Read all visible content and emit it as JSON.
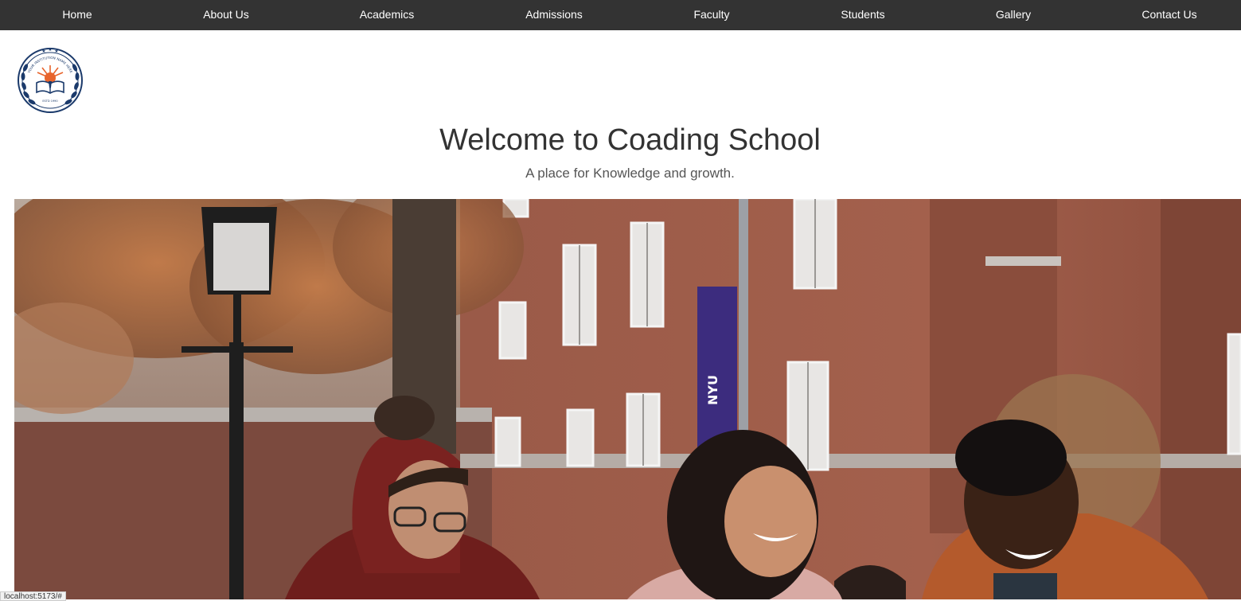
{
  "nav": {
    "items": [
      {
        "label": "Home"
      },
      {
        "label": "About Us"
      },
      {
        "label": "Academics"
      },
      {
        "label": "Admissions"
      },
      {
        "label": "Faculty"
      },
      {
        "label": "Students"
      },
      {
        "label": "Gallery"
      },
      {
        "label": "Contact Us"
      }
    ]
  },
  "hero": {
    "title": "Welcome to Coading School",
    "subtitle": "A place for Knowledge and growth."
  },
  "logo": {
    "text": "YOUR INSTITUTION NAME HERE",
    "est": "ESTD 1990"
  },
  "status_bar": {
    "url": "localhost:5173/#"
  },
  "colors": {
    "nav_bg": "#333333",
    "nav_text": "#ffffff",
    "title_text": "#333333",
    "subtitle_text": "#555555",
    "logo_navy": "#1b3a6b",
    "logo_orange": "#e8642c"
  }
}
